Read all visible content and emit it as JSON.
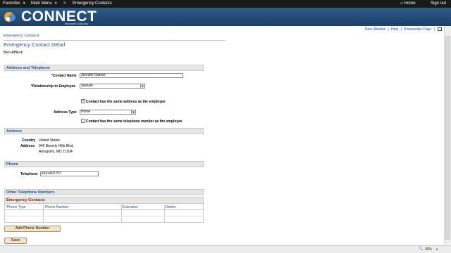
{
  "topnav": {
    "favorites": "Favorites",
    "main_menu": "Main Menu",
    "breadcrumb_sep": ">",
    "breadcrumb_current": "Emergency Contacts",
    "home": "Home",
    "sign_out": "Sign out"
  },
  "banner": {
    "logo_text": "CONNECT",
    "logo_sub": "Maryland Judiciary"
  },
  "pagebar": {
    "new_window": "New Window",
    "help": "Help",
    "personalize": "Personalize Page",
    "sep": "|"
  },
  "page": {
    "breadcrumb": "Emergency Contacts",
    "title": "Emergency Contact Detail",
    "employee": "Ben Affleck"
  },
  "address_telephone": {
    "section_title": "Address and Telephone",
    "contact_name_label": "*Contact Name",
    "contact_name_value": "Jennifer Garner",
    "relationship_label": "*Relationship to Employee",
    "relationship_value": "Spouse",
    "same_address_label": "Contact has the same address as the employee",
    "address_type_label": "Address Type",
    "address_type_value": "Home",
    "same_phone_label": "Contact has the same telephone number as the employee"
  },
  "address": {
    "section_title": "Address",
    "country_label": "Country",
    "country_value": "United States",
    "address_label": "Address",
    "address_line1": "946 Beverly Hills Blvd.",
    "address_line2": "Annapolis, MD 21204"
  },
  "phone": {
    "section_title": "Phone",
    "telephone_label": "Telephone",
    "telephone_value": "4102402797"
  },
  "other_numbers": {
    "section_title": "Other Telephone Numbers",
    "grid_title": "Emergency Contacts",
    "columns": [
      "*Phone Type",
      "Phone Number",
      "Extension",
      "Delete"
    ],
    "add_button": "Add Phone Number"
  },
  "save_button": "Save",
  "statusbar": {
    "zoom": "90%"
  },
  "colors": {
    "link": "#1e4f9c",
    "section_bg": "#e6e6e6",
    "banner": "#2d5b8c",
    "button_bg": "#f5e4c4"
  }
}
